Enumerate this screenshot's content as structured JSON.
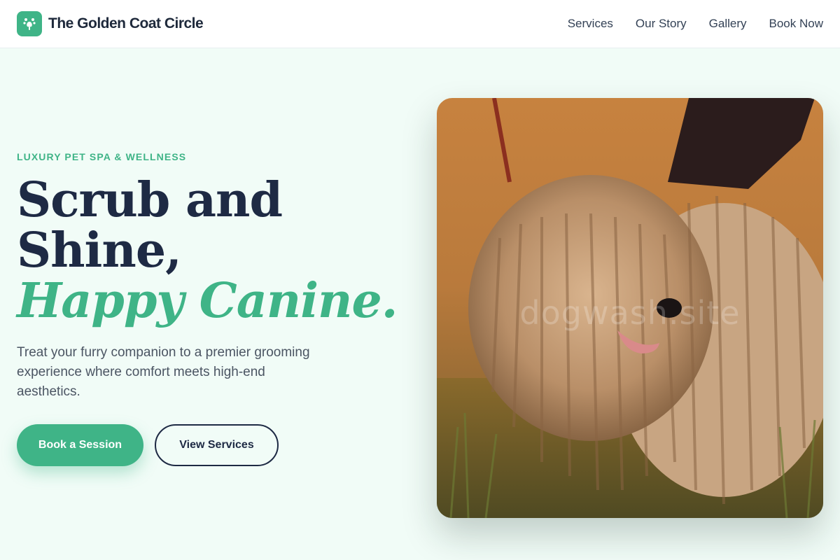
{
  "brand": {
    "name": "The Golden Coat Circle",
    "logo_icon": "paw-icon",
    "accent_color": "#3fb487"
  },
  "nav": {
    "items": [
      {
        "label": "Services"
      },
      {
        "label": "Our Story"
      },
      {
        "label": "Gallery"
      },
      {
        "label": "Book Now"
      }
    ]
  },
  "hero": {
    "eyebrow": "LUXURY PET SPA & WELLNESS",
    "headline_line1": "Scrub and",
    "headline_line2": "Shine,",
    "headline_accent": "Happy Canine.",
    "lede": "Treat your furry companion to a premier grooming experience where comfort meets high-end aesthetics.",
    "primary_cta": "Book a Session",
    "secondary_cta": "View Services",
    "image_watermark": "dogwash.site"
  }
}
